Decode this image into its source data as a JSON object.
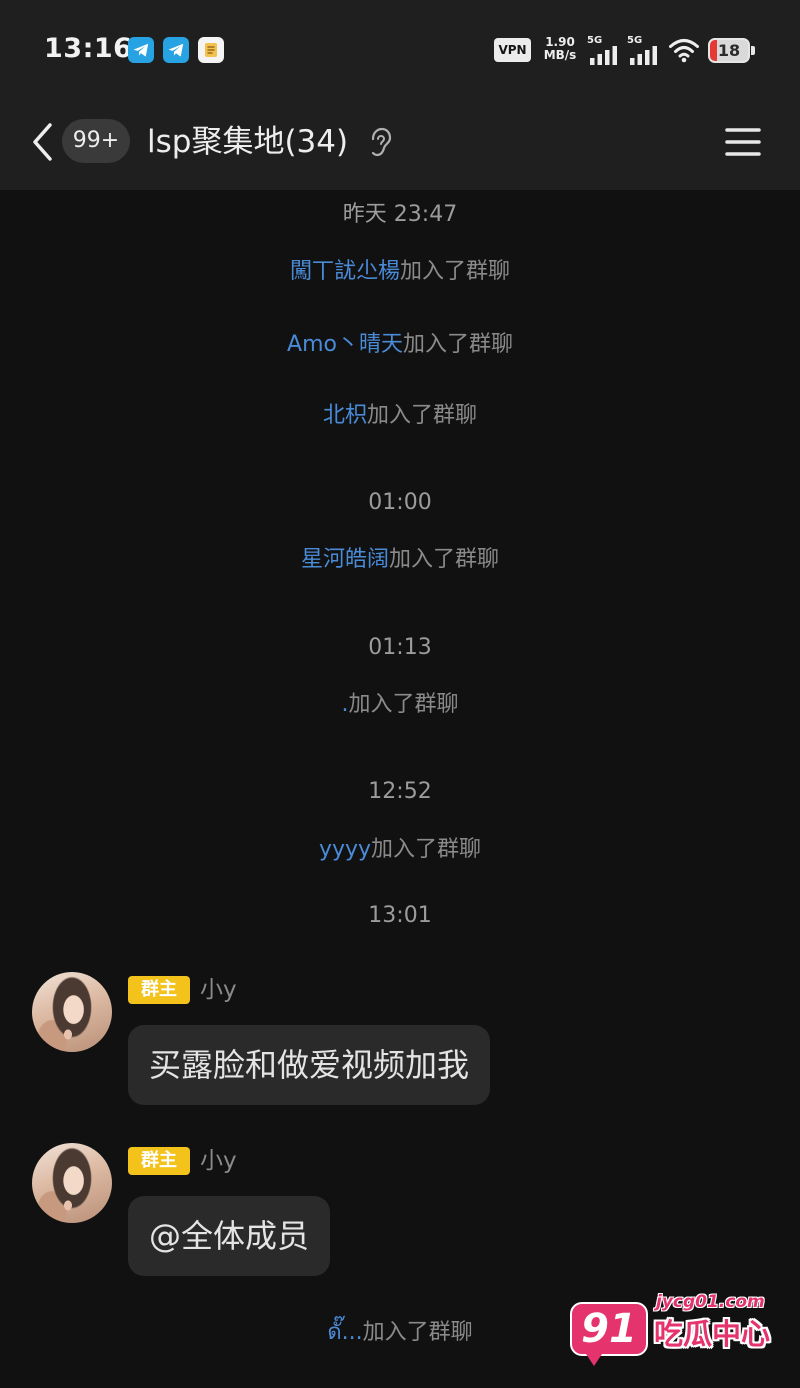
{
  "status_bar": {
    "time": "13:16",
    "notification_icons": [
      "telegram-icon",
      "telegram-icon",
      "app-icon"
    ],
    "vpn_label": "VPN",
    "net_speed": "1.90",
    "net_speed_unit": "MB/s",
    "signals": [
      {
        "label": "5G",
        "icon": "signal-bars-icon"
      },
      {
        "label": "5G",
        "icon": "signal-bars-icon"
      }
    ],
    "wifi_icon": "wifi-icon",
    "battery_text": "18",
    "battery_level": 0.18
  },
  "header": {
    "back_icon": "chevron-left-icon",
    "unread_badge": "99+",
    "title": "lsp聚集地(34)",
    "status_icon": "ear-icon",
    "menu_icon": "menu-icon"
  },
  "colors": {
    "top_bar_bg": "#1f1f1f",
    "chat_bg": "#111111",
    "member_name": "#4a8bd8",
    "system_text": "#8a8a8a",
    "timestamp_text": "#9c9c9c",
    "bubble_bg": "#2a2a2a",
    "owner_badge": "#f3c21b",
    "battery_low": "#e53935",
    "watermark_pink": "#e5336d"
  },
  "chat": {
    "items": [
      {
        "time": "昨天 23:47"
      },
      {
        "name": "闖丅訧尐楊",
        "action": "加入了群聊"
      },
      {
        "name": "Amo丶晴天",
        "action": "加入了群聊"
      },
      {
        "name": "北枳",
        "action": "加入了群聊"
      },
      {
        "time": "01:00"
      },
      {
        "name": "星河皓阔",
        "action": "加入了群聊"
      },
      {
        "time": "01:13"
      },
      {
        "name": ".",
        "action": "加入了群聊"
      },
      {
        "time": "12:52"
      },
      {
        "name": "yyyy",
        "action": "加入了群聊"
      },
      {
        "time": "13:01"
      },
      {
        "badge": "群主",
        "sender": "小y",
        "text": "买露脸和做爱视频加我"
      },
      {
        "badge": "群主",
        "sender": "小y",
        "text": "@全体成员"
      },
      {
        "name": "ดั๊...",
        "action": "加入了群聊"
      }
    ]
  },
  "watermark": {
    "number": "91",
    "domain": "jycg01.com",
    "name": "吃瓜中心"
  }
}
